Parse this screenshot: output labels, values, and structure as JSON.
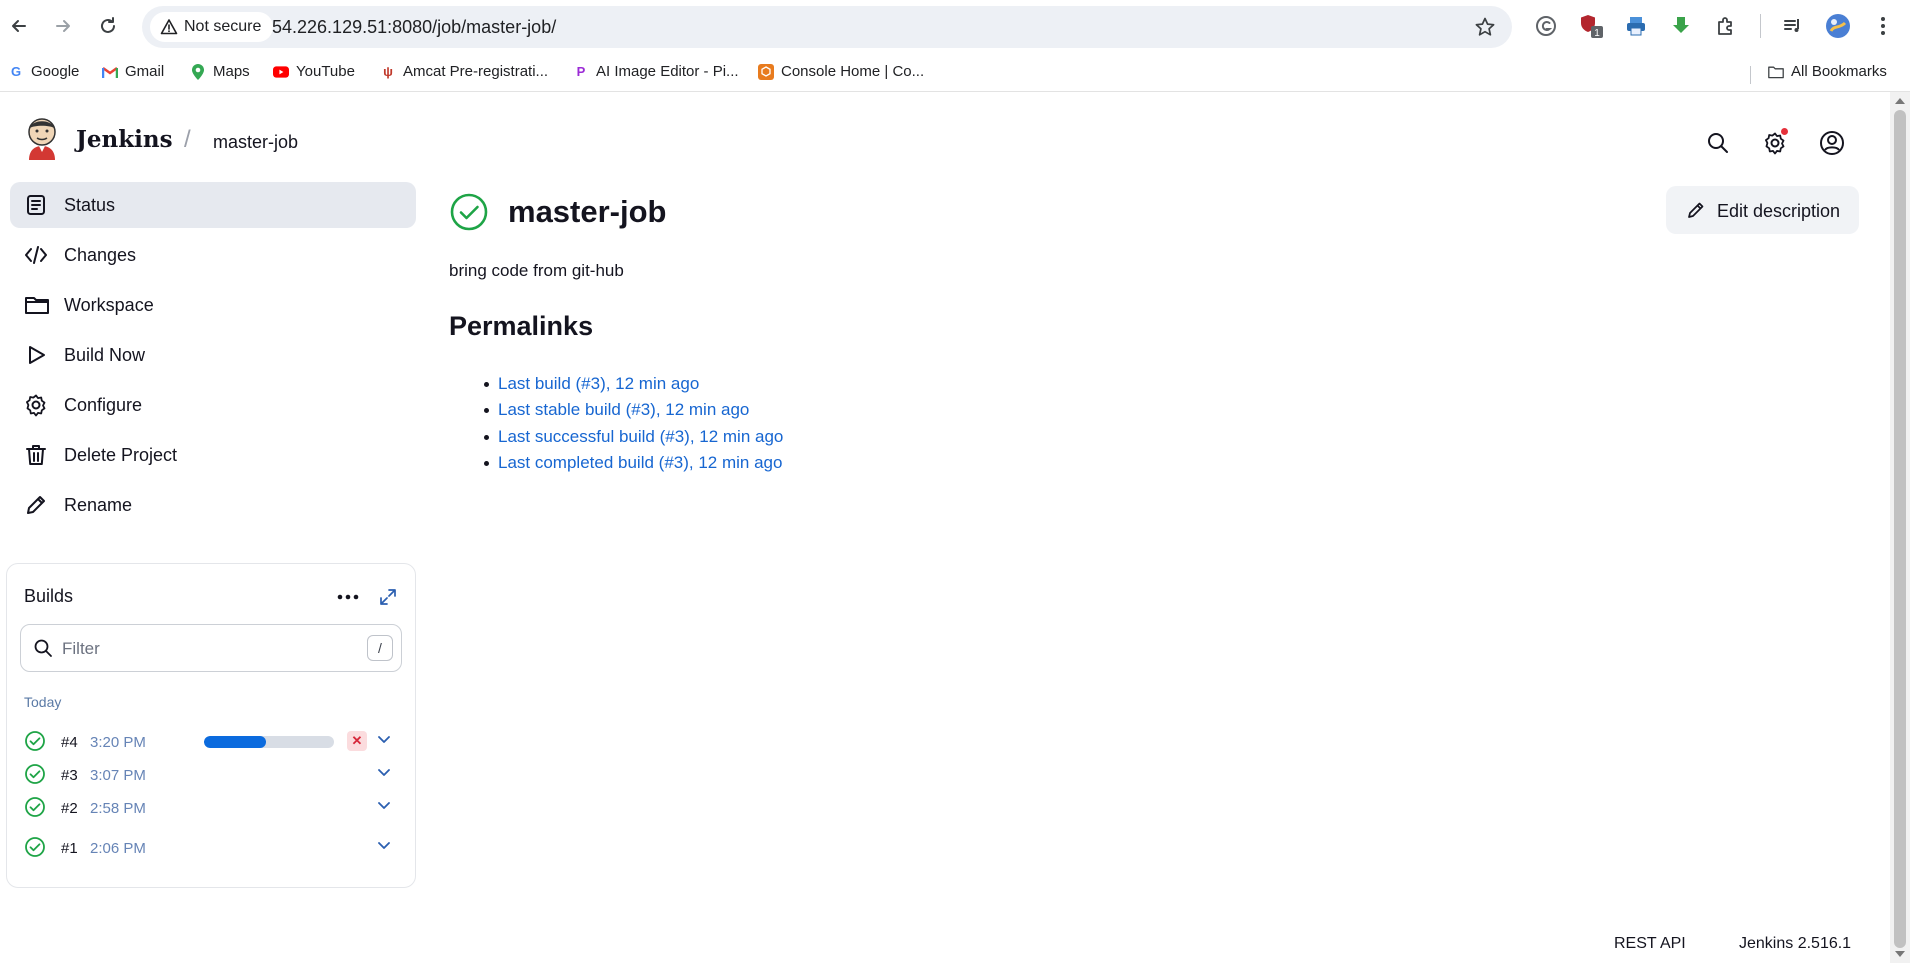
{
  "browser": {
    "security_label": "Not secure",
    "url": "54.226.129.51:8080/job/master-job/",
    "extension_badge": "1",
    "bookmarks": [
      {
        "label": "Google",
        "icon": "google-icon"
      },
      {
        "label": "Gmail",
        "icon": "gmail-icon"
      },
      {
        "label": "Maps",
        "icon": "maps-icon"
      },
      {
        "label": "YouTube",
        "icon": "youtube-icon"
      },
      {
        "label": "Amcat Pre-registrati...",
        "icon": "amcat-icon"
      },
      {
        "label": "AI Image Editor - Pi...",
        "icon": "picsart-icon"
      },
      {
        "label": "Console Home | Co...",
        "icon": "aws-icon"
      }
    ],
    "all_bookmarks_label": "All Bookmarks"
  },
  "header": {
    "brand": "Jenkins",
    "breadcrumb_separator": "/",
    "breadcrumb": "master-job"
  },
  "sidebar": {
    "items": [
      {
        "label": "Status",
        "icon": "status-icon"
      },
      {
        "label": "Changes",
        "icon": "code-icon"
      },
      {
        "label": "Workspace",
        "icon": "folder-icon"
      },
      {
        "label": "Build Now",
        "icon": "play-icon"
      },
      {
        "label": "Configure",
        "icon": "gear-icon"
      },
      {
        "label": "Delete Project",
        "icon": "trash-icon"
      },
      {
        "label": "Rename",
        "icon": "pencil-icon"
      }
    ]
  },
  "builds": {
    "title": "Builds",
    "filter_placeholder": "Filter",
    "filter_shortcut": "/",
    "group_label": "Today",
    "rows": [
      {
        "number": "#4",
        "time": "3:20 PM",
        "in_progress": true,
        "progress": 0.48
      },
      {
        "number": "#3",
        "time": "3:07 PM",
        "in_progress": false
      },
      {
        "number": "#2",
        "time": "2:58 PM",
        "in_progress": false
      },
      {
        "number": "#1",
        "time": "2:06 PM",
        "in_progress": false
      }
    ]
  },
  "main": {
    "title": "master-job",
    "edit_description_label": "Edit description",
    "description": "bring code from git-hub",
    "permalinks_title": "Permalinks",
    "permalinks": [
      "Last build (#3), 12 min ago",
      "Last stable build (#3), 12 min ago",
      "Last successful build (#3), 12 min ago",
      "Last completed build (#3), 12 min ago"
    ]
  },
  "footer": {
    "rest_api": "REST API",
    "version": "Jenkins 2.516.1"
  },
  "colors": {
    "success": "#1ea446",
    "link": "#1766d1",
    "progress": "#0b6bde",
    "active_bg": "#e6e9ef"
  }
}
